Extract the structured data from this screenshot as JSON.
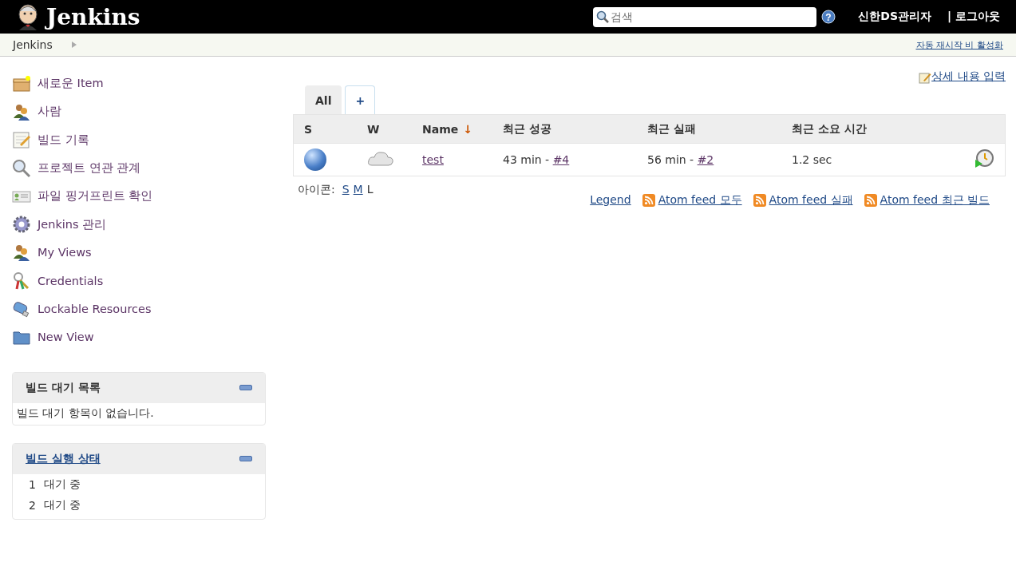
{
  "header": {
    "logo_text": "Jenkins",
    "search": {
      "placeholder": "검색"
    },
    "help": "?",
    "user": "신한DS관리자",
    "logout": "| 로그아웃"
  },
  "breadcrumb": {
    "items": [
      "Jenkins"
    ],
    "auto_refresh": "자동 재시작 비 활성화"
  },
  "tasks": [
    "새로운 Item",
    "사람",
    "빌드 기록",
    "프로젝트 연관 관계",
    "파일 핑거프린트 확인",
    "Jenkins 관리",
    "My Views",
    "Credentials",
    "Lockable Resources",
    "New View"
  ],
  "build_queue": {
    "title": "빌드 대기 목록",
    "message": "빌드 대기 항목이 없습니다."
  },
  "executors": {
    "title": "빌드 실행 상태",
    "items": [
      {
        "number": "1",
        "status": "대기 중"
      },
      {
        "number": "2",
        "status": "대기 중"
      }
    ]
  },
  "description_link": "상세 내용 입력",
  "tabs": [
    {
      "label": "All",
      "selected": true
    },
    {
      "label": "+",
      "selected": false
    }
  ],
  "table": {
    "columns": [
      "S",
      "W",
      "Name",
      "최근 성공",
      "최근 실패",
      "최근 소요 시간"
    ],
    "sort_arrow": "↓",
    "rows": [
      {
        "name": "test",
        "last_success": {
          "text": "43 min - ",
          "build": "#4"
        },
        "last_failure": {
          "text": "56 min - ",
          "build": "#2"
        },
        "last_duration": "1.2 sec"
      }
    ]
  },
  "icon_size": {
    "label": "아이콘:",
    "options": [
      {
        "label": "S",
        "selected": false
      },
      {
        "label": "M",
        "selected": false
      },
      {
        "label": "L",
        "selected": true
      }
    ]
  },
  "feeds": {
    "legend": "Legend",
    "links": [
      "Atom feed 모두",
      "Atom feed 실패",
      "Atom feed 최근 빌드"
    ]
  }
}
